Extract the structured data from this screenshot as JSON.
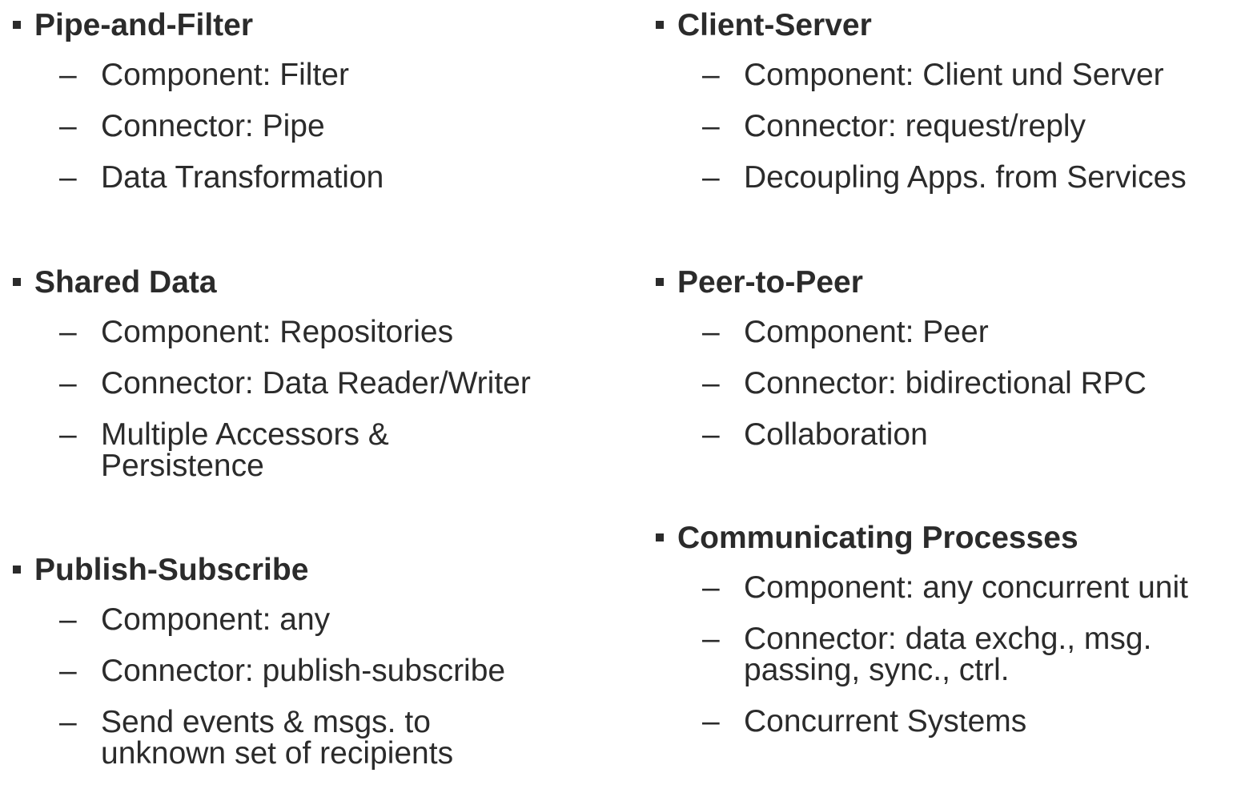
{
  "sections": [
    {
      "heading": "Pipe-and-Filter",
      "items": [
        "Component: Filter",
        "Connector: Pipe",
        "Data Transformation"
      ]
    },
    {
      "heading": "Shared Data",
      "items": [
        "Component: Repositories",
        "Connector: Data Reader/Writer",
        "Multiple Accessors &\nPersistence"
      ]
    },
    {
      "heading": "Publish-Subscribe",
      "items": [
        "Component: any",
        "Connector: publish-subscribe",
        "Send events & msgs. to\nunknown set of recipients"
      ]
    },
    {
      "heading": "Client-Server",
      "items": [
        "Component: Client und Server",
        "Connector: request/reply",
        "Decoupling Apps. from Services"
      ]
    },
    {
      "heading": "Peer-to-Peer",
      "items": [
        "Component: Peer",
        "Connector: bidirectional RPC",
        "Collaboration"
      ]
    },
    {
      "heading": "Communicating Processes",
      "items": [
        "Component: any concurrent unit",
        "Connector: data exchg., msg.\npassing, sync., ctrl.",
        "Concurrent Systems"
      ]
    }
  ],
  "dash_glyph": "–"
}
